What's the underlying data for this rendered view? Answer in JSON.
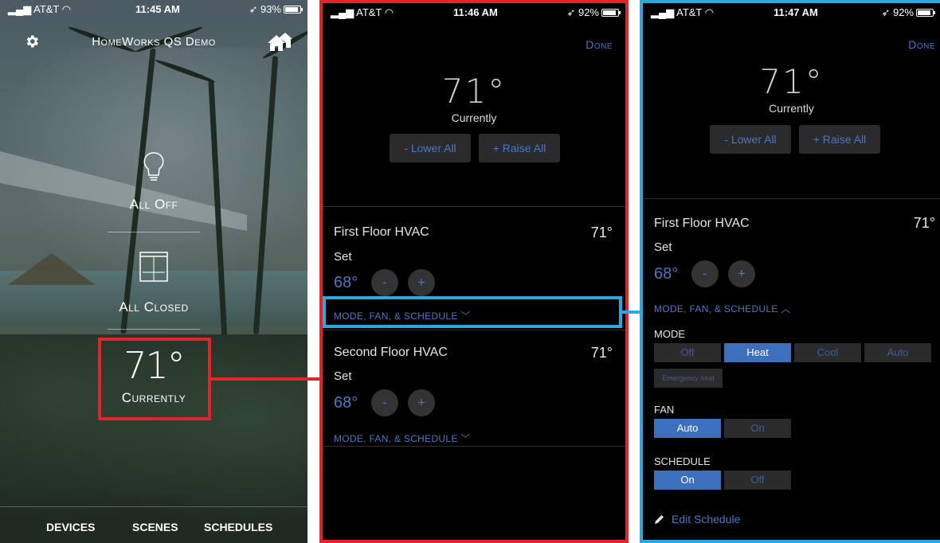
{
  "screen1": {
    "status": {
      "carrier": "AT&T",
      "time": "11:45 AM",
      "battery": "93%"
    },
    "title": "HomeWorks QS Demo",
    "all_off_label": "All Off",
    "all_closed_label": "All Closed",
    "temperature": "71°",
    "temperature_label": "Currently",
    "tabs": [
      "DEVICES",
      "SCENES",
      "SCHEDULES"
    ]
  },
  "screen2": {
    "status": {
      "carrier": "AT&T",
      "time": "11:46 AM",
      "battery": "92%"
    },
    "done_label": "Done",
    "temperature": "71°",
    "temperature_label": "Currently",
    "lower_all": "- Lower All",
    "raise_all": "+ Raise All",
    "zones": [
      {
        "name": "First Floor HVAC",
        "temp": "71°",
        "set_label": "Set",
        "setpoint": "68°",
        "minus": "-",
        "plus": "+",
        "link": "MODE, FAN, & SCHEDULE"
      },
      {
        "name": "Second Floor HVAC",
        "temp": "71°",
        "set_label": "Set",
        "setpoint": "68°",
        "minus": "-",
        "plus": "+",
        "link": "MODE, FAN, & SCHEDULE"
      }
    ]
  },
  "screen3": {
    "status": {
      "carrier": "AT&T",
      "time": "11:47 AM",
      "battery": "92%"
    },
    "done_label": "Done",
    "temperature": "71°",
    "temperature_label": "Currently",
    "lower_all": "- Lower All",
    "raise_all": "+ Raise All",
    "zone": {
      "name": "First Floor HVAC",
      "temp": "71°",
      "set_label": "Set",
      "setpoint": "68°",
      "minus": "-",
      "plus": "+",
      "link": "MODE, FAN, & SCHEDULE"
    },
    "mode_label": "MODE",
    "mode_options": [
      "Off",
      "Heat",
      "Cool",
      "Auto"
    ],
    "mode_selected": "Heat",
    "emergency_heat": "Emergency heat",
    "fan_label": "FAN",
    "fan_options": [
      "Auto",
      "On"
    ],
    "fan_selected": "Auto",
    "schedule_label": "SCHEDULE",
    "schedule_options": [
      "On",
      "Off"
    ],
    "schedule_selected": "On",
    "edit_schedule": "Edit Schedule"
  },
  "colors": {
    "accent_blue": "#4a78c2",
    "highlight_red": "#e3232b",
    "highlight_cyan": "#29a9df",
    "segment_active": "#3d6fbf"
  }
}
